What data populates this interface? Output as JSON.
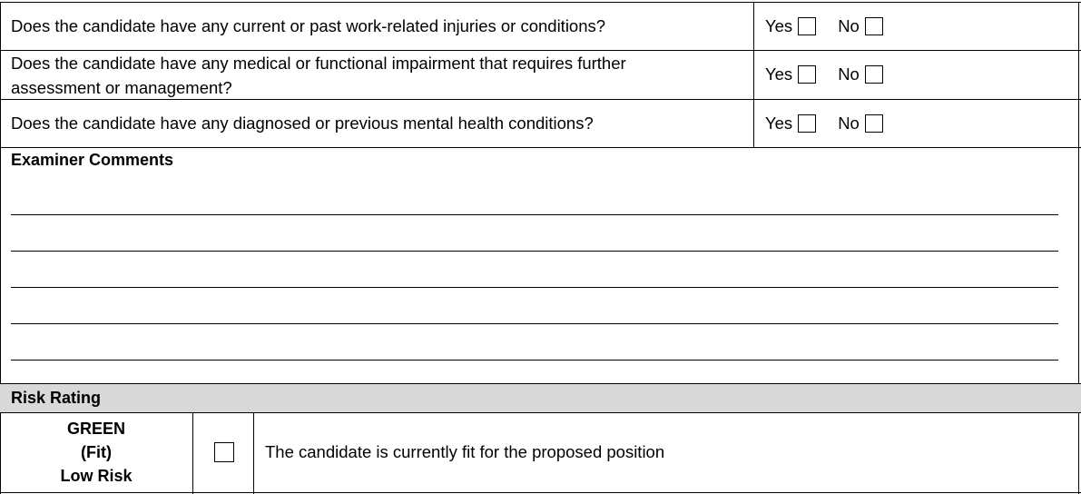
{
  "questions": [
    {
      "text": "Does the candidate have any current or past work-related injuries or conditions?",
      "yes_label": "Yes",
      "no_label": "No"
    },
    {
      "text": "Does the candidate have any medical or functional impairment that requires further assessment or management?",
      "yes_label": "Yes",
      "no_label": "No"
    },
    {
      "text": "Does the candidate have any diagnosed or previous mental health conditions?",
      "yes_label": "Yes",
      "no_label": "No"
    }
  ],
  "examiner_comments": {
    "heading": "Examiner Comments"
  },
  "risk_rating": {
    "heading": "Risk Rating",
    "rows": [
      {
        "level": "GREEN",
        "status": "(Fit)",
        "risk": "Low Risk",
        "description": "The candidate is currently fit for the proposed position"
      }
    ]
  }
}
